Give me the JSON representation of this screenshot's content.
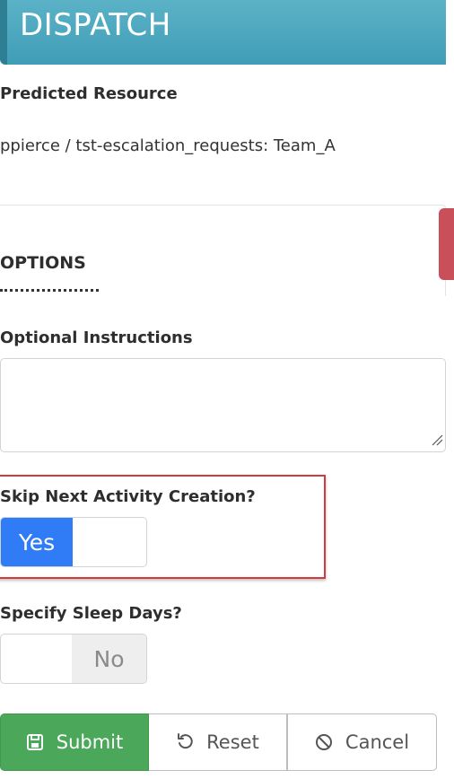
{
  "header": {
    "title": "DISPATCH"
  },
  "predicted_resource": {
    "label": "Predicted Resource",
    "value": "ppierce / tst-escalation_requests: Team_A"
  },
  "options": {
    "title": "OPTIONS"
  },
  "optional_instructions": {
    "label": "Optional Instructions",
    "value": ""
  },
  "skip_next_activity": {
    "label": "Skip Next Activity Creation?",
    "state_label": "Yes",
    "checked": true
  },
  "specify_sleep_days": {
    "label": "Specify Sleep Days?",
    "state_label": "No",
    "checked": false
  },
  "actions": {
    "submit_label": "Submit",
    "reset_label": "Reset",
    "cancel_label": "Cancel"
  },
  "icons": {
    "submit": "save-icon",
    "reset": "undo-icon",
    "cancel": "ban-icon"
  },
  "colors": {
    "header": "#4aa7bf",
    "toggle_on": "#2f7cf6",
    "submit": "#4ba85a",
    "highlight": "#d23b3b",
    "side_tab": "#c9505a"
  }
}
